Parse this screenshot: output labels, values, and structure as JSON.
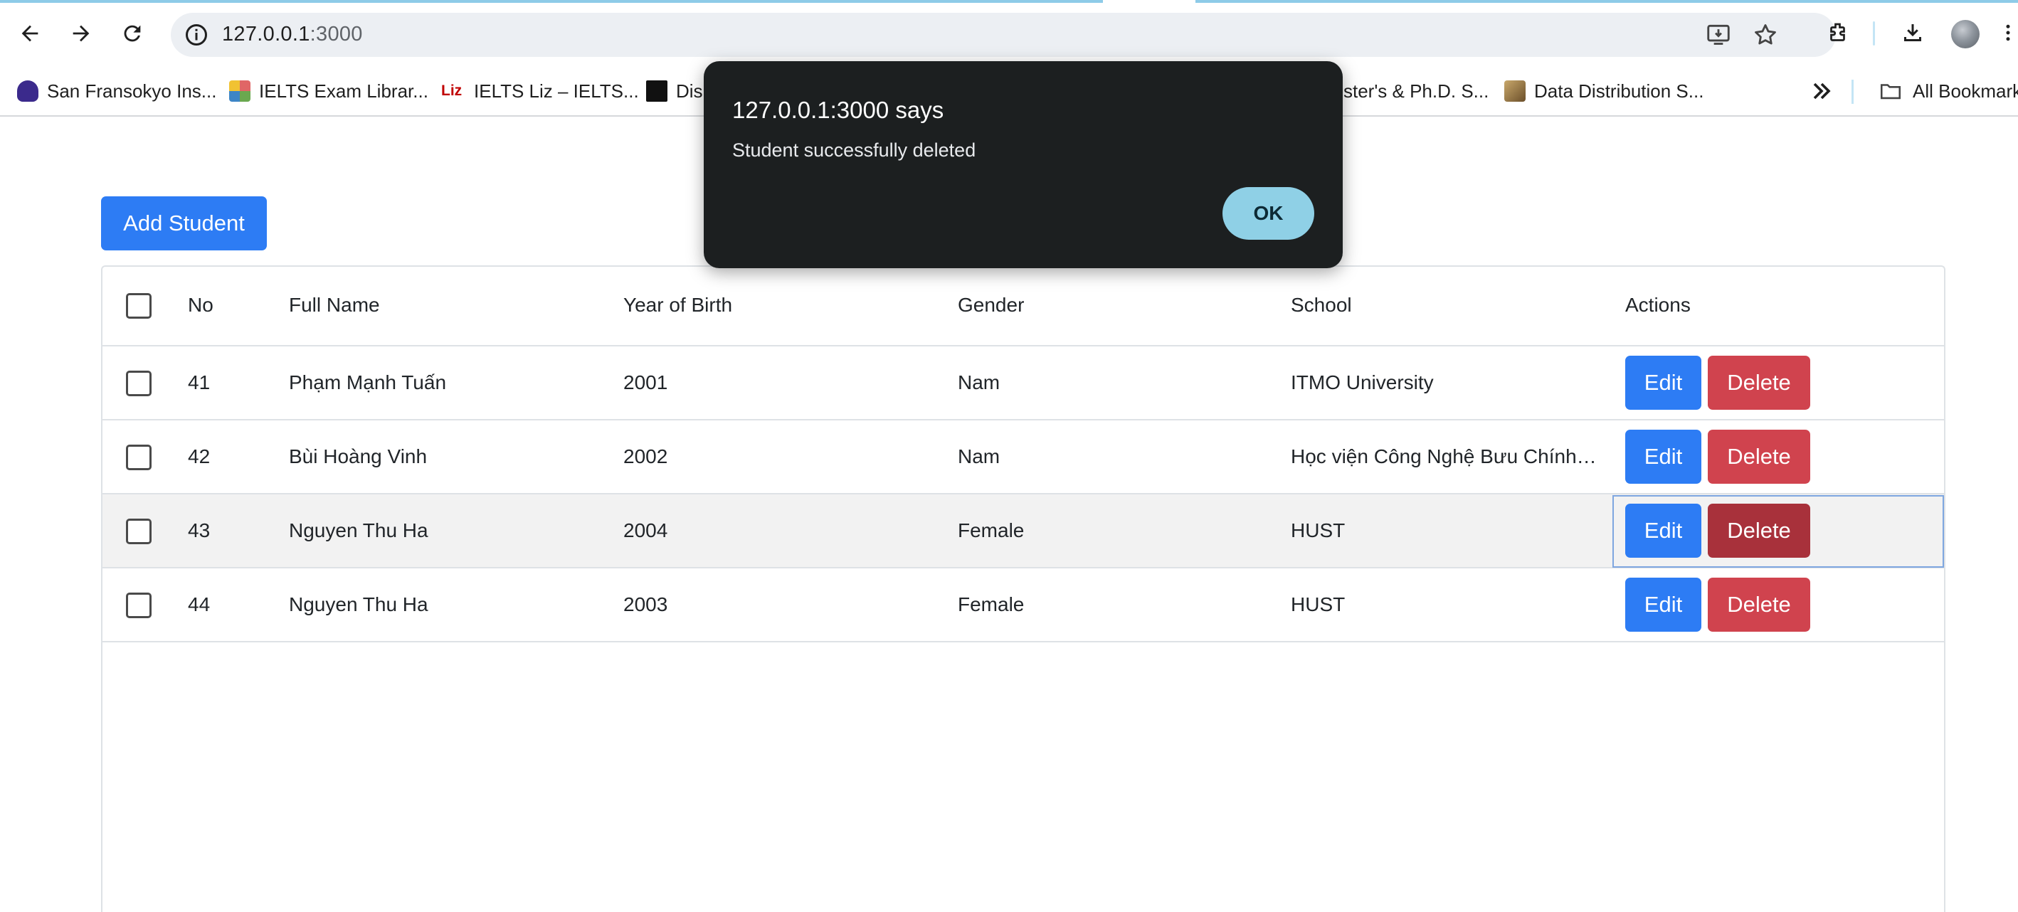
{
  "browser": {
    "url_host": "127.0.0.1",
    "url_port": ":3000",
    "icons": [
      "back-arrow-icon",
      "forward-arrow-icon",
      "reload-icon",
      "site-info-icon",
      "install-app-icon",
      "bookmark-star-icon",
      "extensions-icon",
      "downloads-icon",
      "profile-avatar",
      "menu-icon"
    ]
  },
  "bookmarks": {
    "items": [
      {
        "label": "San Fransokyo Ins...",
        "color": "#3b2a8c"
      },
      {
        "label": "IELTS Exam Librar...",
        "color": "#6aa84f"
      },
      {
        "label": "IELTS Liz – IELTS...",
        "color": "#c00000"
      },
      {
        "label": "Dis",
        "color": "#111111"
      },
      {
        "label": "ster's & Ph.D. S...",
        "color": ""
      },
      {
        "label": "Data Distribution S...",
        "color": "#8a6d3b"
      }
    ],
    "favicon_text_liz": "Liz",
    "all_bookmarks": "All Bookmarks"
  },
  "page": {
    "add_button": "Add Student",
    "columns": [
      "No",
      "Full Name",
      "Year of Birth",
      "Gender",
      "School",
      "Actions"
    ],
    "rows": [
      {
        "no": "41",
        "name": "Phạm Mạnh Tuấn",
        "year": "2001",
        "gender": "Nam",
        "school": "ITMO University"
      },
      {
        "no": "42",
        "name": "Bùi Hoàng Vinh",
        "year": "2002",
        "gender": "Nam",
        "school": "Học viện Công Nghệ Bưu Chính Viễn Thông"
      },
      {
        "no": "43",
        "name": "Nguyen Thu Ha",
        "year": "2004",
        "gender": "Female",
        "school": "HUST"
      },
      {
        "no": "44",
        "name": "Nguyen Thu Ha",
        "year": "2003",
        "gender": "Female",
        "school": "HUST"
      }
    ],
    "edit_label": "Edit",
    "delete_label": "Delete"
  },
  "dialog": {
    "title": "127.0.0.1:3000 says",
    "message": "Student successfully deleted",
    "ok": "OK"
  }
}
